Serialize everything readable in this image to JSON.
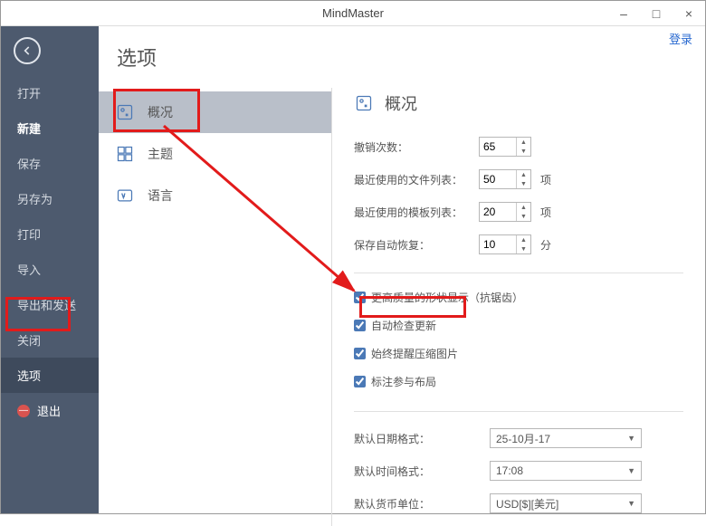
{
  "window": {
    "title": "MindMaster",
    "login": "登录"
  },
  "sidebar": {
    "items": [
      {
        "label": "打开"
      },
      {
        "label": "新建"
      },
      {
        "label": "保存"
      },
      {
        "label": "另存为"
      },
      {
        "label": "打印"
      },
      {
        "label": "导入"
      },
      {
        "label": "导出和发送"
      },
      {
        "label": "关闭"
      },
      {
        "label": "选项"
      },
      {
        "label": "退出"
      }
    ]
  },
  "page": {
    "title": "选项"
  },
  "categories": {
    "overview": "概况",
    "theme": "主题",
    "language": "语言"
  },
  "settings": {
    "header": "概况",
    "undo_label": "撤销次数：",
    "undo_value": "65",
    "recent_files_label": "最近使用的文件列表：",
    "recent_files_value": "50",
    "recent_files_unit": "项",
    "recent_templates_label": "最近使用的模板列表：",
    "recent_templates_value": "20",
    "recent_templates_unit": "项",
    "autosave_label": "保存自动恢复：",
    "autosave_value": "10",
    "autosave_unit": "分",
    "chk_hq": "更高质量的形状显示（抗锯齿）",
    "chk_update": "自动检查更新",
    "chk_compress": "始终提醒压缩图片",
    "chk_layout": "标注参与布局",
    "date_label": "默认日期格式：",
    "date_value": "25-10月-17",
    "time_label": "默认时间格式：",
    "time_value": "17:08",
    "currency_label": "默认货币单位：",
    "currency_value": "USD[$][美元]"
  }
}
